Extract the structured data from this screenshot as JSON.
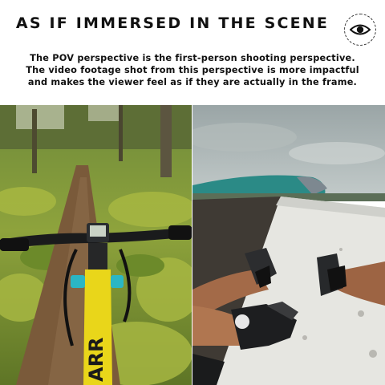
{
  "header": {
    "title": "AS IF IMMERSED IN THE SCENE",
    "icon": "eye-icon",
    "description_lines": [
      "The POV perspective is the first-person shooting perspective.",
      "The video footage shot from this perspective is more impactful",
      "and makes the viewer feel as if they are actually in the frame."
    ]
  },
  "photos": {
    "left": {
      "subject": "mountain-bike-handlebar-forest-trail",
      "fork_text": "ARR"
    },
    "right": {
      "subject": "feet-on-plane-wing-pov"
    }
  },
  "colors": {
    "text": "#111111",
    "fork_yellow": "#e9d61a"
  }
}
